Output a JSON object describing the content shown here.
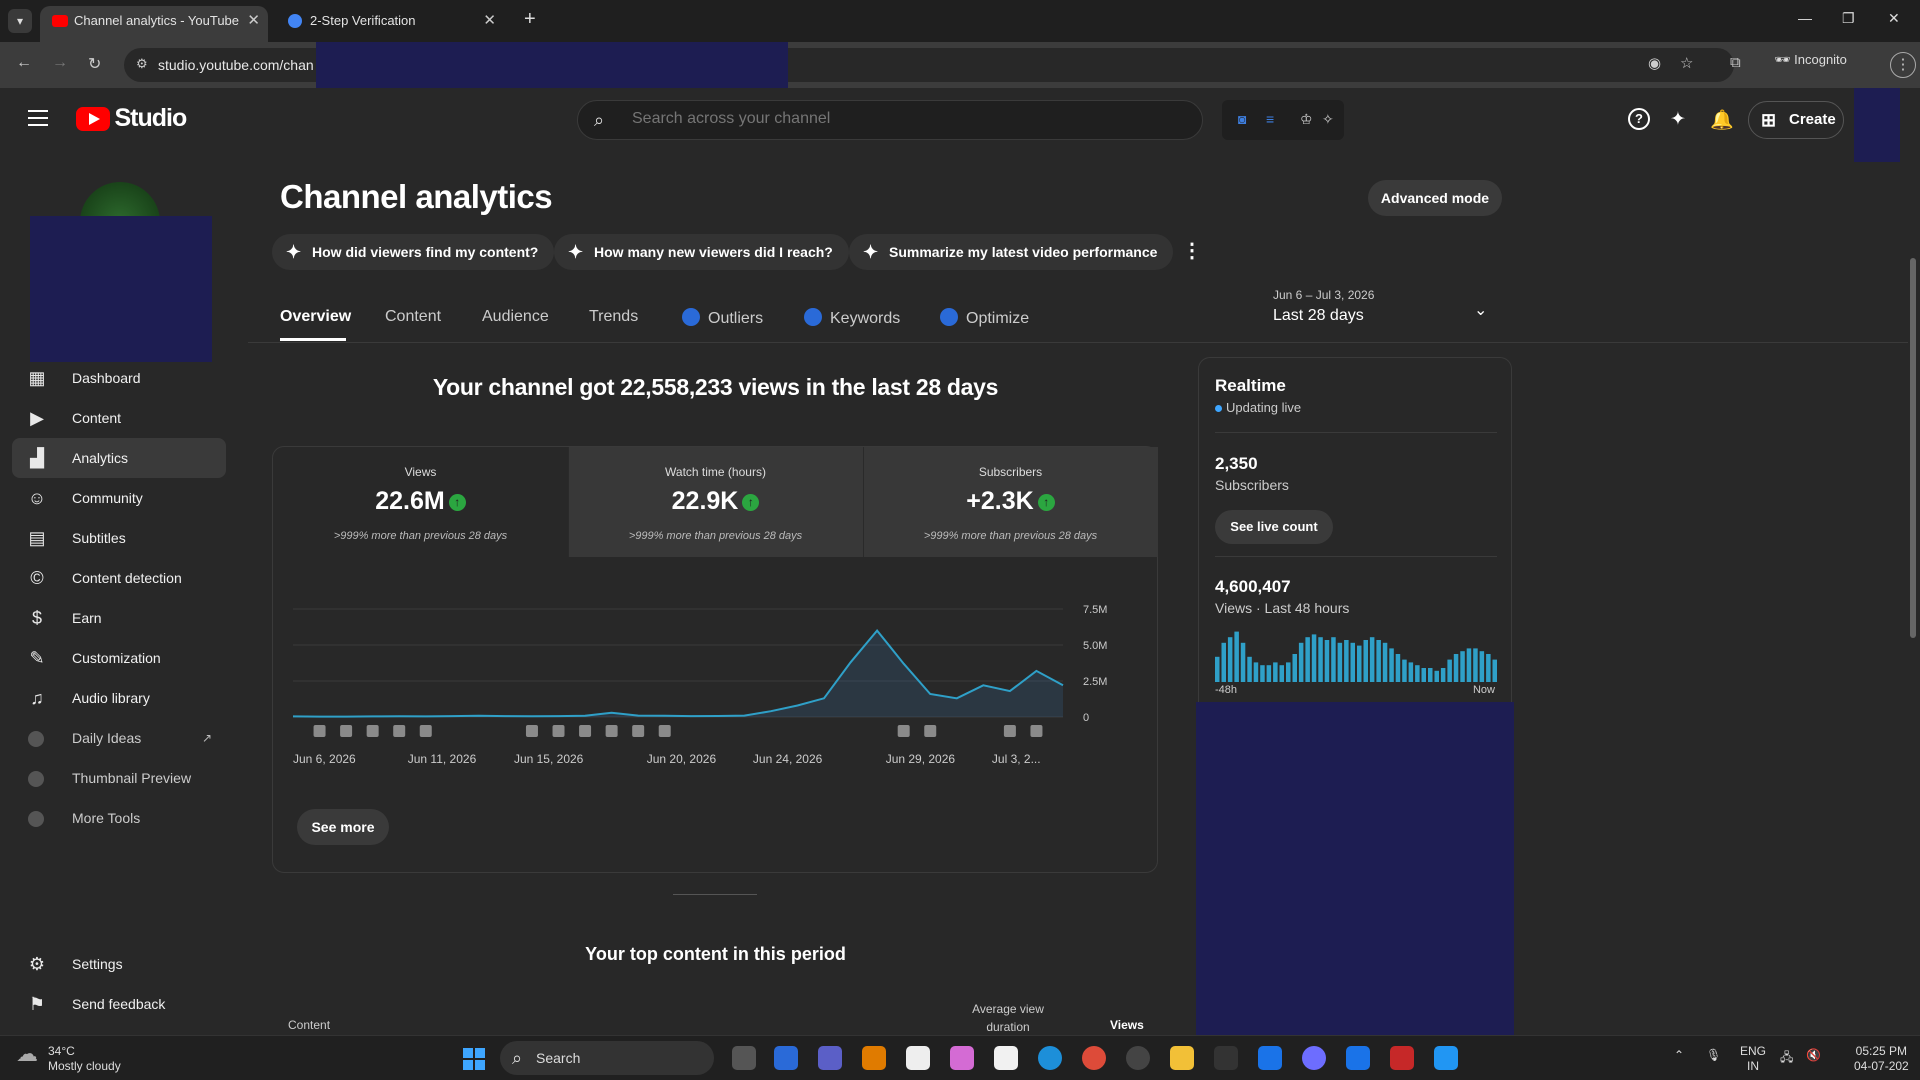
{
  "browser": {
    "tabs": [
      {
        "title": "Channel analytics - YouTube Stu",
        "active": true
      },
      {
        "title": "2-Step Verification",
        "active": false
      }
    ],
    "url": "studio.youtube.com/chan",
    "incognito_label": "Incognito"
  },
  "app": {
    "brand": "Studio",
    "search_placeholder": "Search across your channel",
    "create_label": "Create"
  },
  "sidebar": {
    "items": [
      {
        "label": "Dashboard",
        "icon": "dashboard-icon"
      },
      {
        "label": "Content",
        "icon": "content-icon"
      },
      {
        "label": "Analytics",
        "icon": "analytics-icon",
        "active": true
      },
      {
        "label": "Community",
        "icon": "community-icon"
      },
      {
        "label": "Subtitles",
        "icon": "subtitles-icon"
      },
      {
        "label": "Content detection",
        "icon": "copyright-icon"
      },
      {
        "label": "Earn",
        "icon": "dollar-icon"
      },
      {
        "label": "Customization",
        "icon": "magic-wand-icon"
      },
      {
        "label": "Audio library",
        "icon": "audio-library-icon"
      },
      {
        "label": "Daily Ideas",
        "icon": "extension-icon"
      },
      {
        "label": "Thumbnail Preview",
        "icon": "extension-icon"
      },
      {
        "label": "More Tools",
        "icon": "extension-icon"
      }
    ],
    "settings": "Settings",
    "feedback": "Send feedback"
  },
  "page": {
    "title": "Channel analytics",
    "advanced_mode": "Advanced mode",
    "chips": [
      "How did viewers find my content?",
      "How many new viewers did I reach?",
      "Summarize my latest video performance"
    ],
    "tabs": [
      "Overview",
      "Content",
      "Audience",
      "Trends",
      "Outliers",
      "Keywords",
      "Optimize"
    ],
    "date_range": "Jun 6 – Jul 3, 2026",
    "date_label": "Last 28 days",
    "headline": "Your channel got 22,558,233 views in the last 28 days",
    "metrics": [
      {
        "label": "Views",
        "value": "22.6M",
        "compare": ">999% more than previous 28 days"
      },
      {
        "label": "Watch time (hours)",
        "value": "22.9K",
        "compare": ">999% more than previous 28 days"
      },
      {
        "label": "Subscribers",
        "value": "+2.3K",
        "compare": ">999% more than previous 28 days"
      }
    ],
    "see_more": "See more",
    "top_content_title": "Your top content in this period",
    "table_headers": {
      "content": "Content",
      "avg_view_duration": "Average view duration",
      "views": "Views"
    }
  },
  "chart_data": {
    "type": "area",
    "x_labels": [
      "Jun 6, 2026",
      "Jun 11, 2026",
      "Jun 15, 2026",
      "Jun 20, 2026",
      "Jun 24, 2026",
      "Jun 29, 2026",
      "Jul 3, 2..."
    ],
    "y_ticks": [
      "7.5M",
      "5.0M",
      "2.5M",
      "0"
    ],
    "ylim": [
      0,
      7500000
    ],
    "series": [
      {
        "values": [
          40000,
          30000,
          30000,
          40000,
          50000,
          40000,
          60000,
          80000,
          60000,
          50000,
          60000,
          80000,
          300000,
          100000,
          80000,
          60000,
          70000,
          100000,
          400000,
          800000,
          1300000,
          3800000,
          6000000,
          3700000,
          1600000,
          1300000,
          2200000,
          1800000,
          3200000,
          2200000
        ]
      }
    ],
    "color": "#3ea6ff"
  },
  "realtime": {
    "title": "Realtime",
    "status": "Updating live",
    "subscribers_value": "2,350",
    "subscribers_label": "Subscribers",
    "live_count_button": "See live count",
    "views_value": "4,600,407",
    "views_label": "Views · Last 48 hours",
    "axis_start": "-48h",
    "axis_end": "Now",
    "bars": [
      0.45,
      0.7,
      0.8,
      0.9,
      0.7,
      0.45,
      0.35,
      0.3,
      0.3,
      0.35,
      0.3,
      0.35,
      0.5,
      0.7,
      0.8,
      0.85,
      0.8,
      0.75,
      0.8,
      0.7,
      0.75,
      0.7,
      0.65,
      0.75,
      0.8,
      0.75,
      0.7,
      0.6,
      0.5,
      0.4,
      0.35,
      0.3,
      0.25,
      0.25,
      0.2,
      0.25,
      0.4,
      0.5,
      0.55,
      0.6,
      0.6,
      0.55,
      0.5,
      0.4
    ]
  },
  "taskbar": {
    "temp": "34°C",
    "weather": "Mostly cloudy",
    "search": "Search",
    "lang": "ENG",
    "region": "IN",
    "time": "05:25 PM",
    "date": "04-07-202"
  }
}
